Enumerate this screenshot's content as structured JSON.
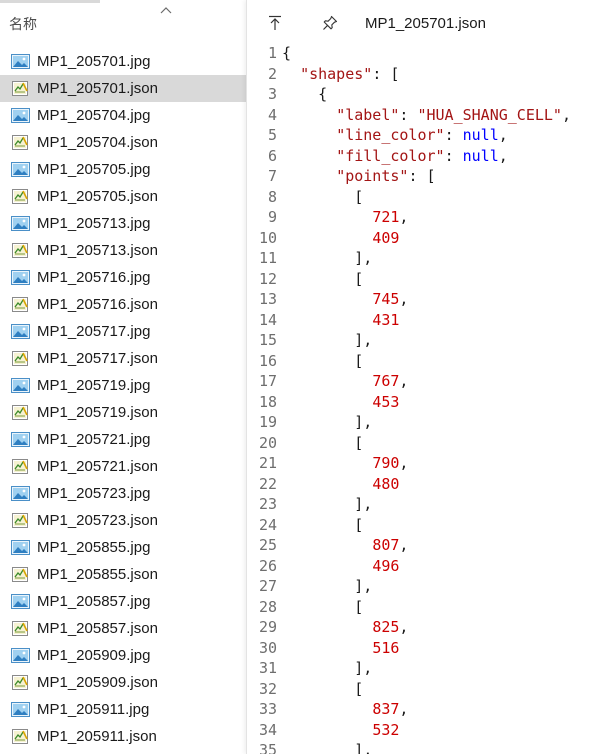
{
  "file_list": {
    "column_header": "名称",
    "items": [
      {
        "name": "MP1_205701.jpg",
        "kind": "image",
        "selected": false
      },
      {
        "name": "MP1_205701.json",
        "kind": "json",
        "selected": true
      },
      {
        "name": "MP1_205704.jpg",
        "kind": "image",
        "selected": false
      },
      {
        "name": "MP1_205704.json",
        "kind": "json",
        "selected": false
      },
      {
        "name": "MP1_205705.jpg",
        "kind": "image",
        "selected": false
      },
      {
        "name": "MP1_205705.json",
        "kind": "json",
        "selected": false
      },
      {
        "name": "MP1_205713.jpg",
        "kind": "image",
        "selected": false
      },
      {
        "name": "MP1_205713.json",
        "kind": "json",
        "selected": false
      },
      {
        "name": "MP1_205716.jpg",
        "kind": "image",
        "selected": false
      },
      {
        "name": "MP1_205716.json",
        "kind": "json",
        "selected": false
      },
      {
        "name": "MP1_205717.jpg",
        "kind": "image",
        "selected": false
      },
      {
        "name": "MP1_205717.json",
        "kind": "json",
        "selected": false
      },
      {
        "name": "MP1_205719.jpg",
        "kind": "image",
        "selected": false
      },
      {
        "name": "MP1_205719.json",
        "kind": "json",
        "selected": false
      },
      {
        "name": "MP1_205721.jpg",
        "kind": "image",
        "selected": false
      },
      {
        "name": "MP1_205721.json",
        "kind": "json",
        "selected": false
      },
      {
        "name": "MP1_205723.jpg",
        "kind": "image",
        "selected": false
      },
      {
        "name": "MP1_205723.json",
        "kind": "json",
        "selected": false
      },
      {
        "name": "MP1_205855.jpg",
        "kind": "image",
        "selected": false
      },
      {
        "name": "MP1_205855.json",
        "kind": "json",
        "selected": false
      },
      {
        "name": "MP1_205857.jpg",
        "kind": "image",
        "selected": false
      },
      {
        "name": "MP1_205857.json",
        "kind": "json",
        "selected": false
      },
      {
        "name": "MP1_205909.jpg",
        "kind": "image",
        "selected": false
      },
      {
        "name": "MP1_205909.json",
        "kind": "json",
        "selected": false
      },
      {
        "name": "MP1_205911.jpg",
        "kind": "image",
        "selected": false
      },
      {
        "name": "MP1_205911.json",
        "kind": "json",
        "selected": false
      }
    ]
  },
  "preview": {
    "title": "MP1_205701.json",
    "buttons": [
      {
        "icon": "pop-out-icon",
        "name": "pop-out-button"
      },
      {
        "icon": "pin-icon",
        "name": "pin-button"
      }
    ],
    "lines": [
      {
        "n": "1",
        "tokens": [
          {
            "t": "p",
            "v": "{"
          }
        ]
      },
      {
        "n": "2",
        "tokens": [
          {
            "t": "p",
            "v": "  "
          },
          {
            "t": "k",
            "v": "\"shapes\""
          },
          {
            "t": "p",
            "v": ": ["
          }
        ]
      },
      {
        "n": "3",
        "tokens": [
          {
            "t": "p",
            "v": "    {"
          }
        ]
      },
      {
        "n": "4",
        "tokens": [
          {
            "t": "p",
            "v": "      "
          },
          {
            "t": "k",
            "v": "\"label\""
          },
          {
            "t": "p",
            "v": ": "
          },
          {
            "t": "s",
            "v": "\"HUA_SHANG_CELL\""
          },
          {
            "t": "p",
            "v": ","
          }
        ]
      },
      {
        "n": "5",
        "tokens": [
          {
            "t": "p",
            "v": "      "
          },
          {
            "t": "k",
            "v": "\"line_color\""
          },
          {
            "t": "p",
            "v": ": "
          },
          {
            "t": "kw",
            "v": "null"
          },
          {
            "t": "p",
            "v": ","
          }
        ]
      },
      {
        "n": "6",
        "tokens": [
          {
            "t": "p",
            "v": "      "
          },
          {
            "t": "k",
            "v": "\"fill_color\""
          },
          {
            "t": "p",
            "v": ": "
          },
          {
            "t": "kw",
            "v": "null"
          },
          {
            "t": "p",
            "v": ","
          }
        ]
      },
      {
        "n": "7",
        "tokens": [
          {
            "t": "p",
            "v": "      "
          },
          {
            "t": "k",
            "v": "\"points\""
          },
          {
            "t": "p",
            "v": ": ["
          }
        ]
      },
      {
        "n": "8",
        "tokens": [
          {
            "t": "p",
            "v": "        ["
          }
        ]
      },
      {
        "n": "9",
        "tokens": [
          {
            "t": "p",
            "v": "          "
          },
          {
            "t": "n",
            "v": "721"
          },
          {
            "t": "p",
            "v": ","
          }
        ]
      },
      {
        "n": "10",
        "tokens": [
          {
            "t": "p",
            "v": "          "
          },
          {
            "t": "n",
            "v": "409"
          }
        ]
      },
      {
        "n": "11",
        "tokens": [
          {
            "t": "p",
            "v": "        ],"
          }
        ]
      },
      {
        "n": "12",
        "tokens": [
          {
            "t": "p",
            "v": "        ["
          }
        ]
      },
      {
        "n": "13",
        "tokens": [
          {
            "t": "p",
            "v": "          "
          },
          {
            "t": "n",
            "v": "745"
          },
          {
            "t": "p",
            "v": ","
          }
        ]
      },
      {
        "n": "14",
        "tokens": [
          {
            "t": "p",
            "v": "          "
          },
          {
            "t": "n",
            "v": "431"
          }
        ]
      },
      {
        "n": "15",
        "tokens": [
          {
            "t": "p",
            "v": "        ],"
          }
        ]
      },
      {
        "n": "16",
        "tokens": [
          {
            "t": "p",
            "v": "        ["
          }
        ]
      },
      {
        "n": "17",
        "tokens": [
          {
            "t": "p",
            "v": "          "
          },
          {
            "t": "n",
            "v": "767"
          },
          {
            "t": "p",
            "v": ","
          }
        ]
      },
      {
        "n": "18",
        "tokens": [
          {
            "t": "p",
            "v": "          "
          },
          {
            "t": "n",
            "v": "453"
          }
        ]
      },
      {
        "n": "19",
        "tokens": [
          {
            "t": "p",
            "v": "        ],"
          }
        ]
      },
      {
        "n": "20",
        "tokens": [
          {
            "t": "p",
            "v": "        ["
          }
        ]
      },
      {
        "n": "21",
        "tokens": [
          {
            "t": "p",
            "v": "          "
          },
          {
            "t": "n",
            "v": "790"
          },
          {
            "t": "p",
            "v": ","
          }
        ]
      },
      {
        "n": "22",
        "tokens": [
          {
            "t": "p",
            "v": "          "
          },
          {
            "t": "n",
            "v": "480"
          }
        ]
      },
      {
        "n": "23",
        "tokens": [
          {
            "t": "p",
            "v": "        ],"
          }
        ]
      },
      {
        "n": "24",
        "tokens": [
          {
            "t": "p",
            "v": "        ["
          }
        ]
      },
      {
        "n": "25",
        "tokens": [
          {
            "t": "p",
            "v": "          "
          },
          {
            "t": "n",
            "v": "807"
          },
          {
            "t": "p",
            "v": ","
          }
        ]
      },
      {
        "n": "26",
        "tokens": [
          {
            "t": "p",
            "v": "          "
          },
          {
            "t": "n",
            "v": "496"
          }
        ]
      },
      {
        "n": "27",
        "tokens": [
          {
            "t": "p",
            "v": "        ],"
          }
        ]
      },
      {
        "n": "28",
        "tokens": [
          {
            "t": "p",
            "v": "        ["
          }
        ]
      },
      {
        "n": "29",
        "tokens": [
          {
            "t": "p",
            "v": "          "
          },
          {
            "t": "n",
            "v": "825"
          },
          {
            "t": "p",
            "v": ","
          }
        ]
      },
      {
        "n": "30",
        "tokens": [
          {
            "t": "p",
            "v": "          "
          },
          {
            "t": "n",
            "v": "516"
          }
        ]
      },
      {
        "n": "31",
        "tokens": [
          {
            "t": "p",
            "v": "        ],"
          }
        ]
      },
      {
        "n": "32",
        "tokens": [
          {
            "t": "p",
            "v": "        ["
          }
        ]
      },
      {
        "n": "33",
        "tokens": [
          {
            "t": "p",
            "v": "          "
          },
          {
            "t": "n",
            "v": "837"
          },
          {
            "t": "p",
            "v": ","
          }
        ]
      },
      {
        "n": "34",
        "tokens": [
          {
            "t": "p",
            "v": "          "
          },
          {
            "t": "n",
            "v": "532"
          }
        ]
      },
      {
        "n": "35",
        "tokens": [
          {
            "t": "p",
            "v": "        ],"
          }
        ]
      }
    ]
  },
  "colors": {
    "selected_row": "#d9d9d9",
    "json_key": "#a31515",
    "json_keyword": "#0000ff",
    "json_number": "#cc0000",
    "line_number": "#6e6e6e"
  }
}
